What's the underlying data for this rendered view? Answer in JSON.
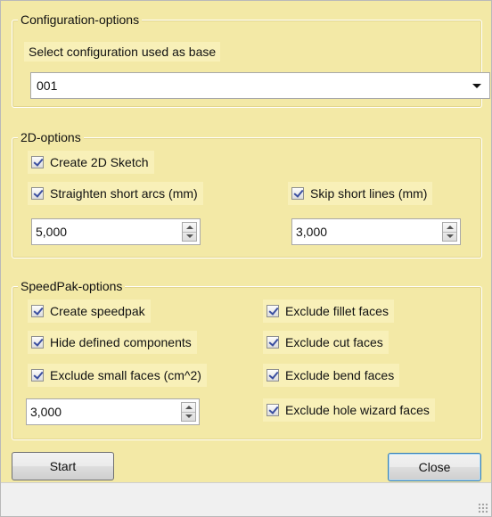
{
  "config": {
    "legend": "Configuration-options",
    "select_label": "Select configuration used as base",
    "selected": "001"
  },
  "twod": {
    "legend": "2D-options",
    "create_sketch": {
      "label": "Create 2D Sketch",
      "checked": true
    },
    "straighten_arcs": {
      "label": "Straighten short arcs (mm)",
      "checked": true
    },
    "straighten_value": "5,000",
    "skip_lines": {
      "label": "Skip short lines (mm)",
      "checked": true
    },
    "skip_value": "3,000"
  },
  "speedpak": {
    "legend": "SpeedPak-options",
    "create_speedpak": {
      "label": "Create speedpak",
      "checked": true
    },
    "hide_components": {
      "label": "Hide defined components",
      "checked": true
    },
    "exclude_small": {
      "label": "Exclude small faces (cm^2)",
      "checked": true
    },
    "small_value": "3,000",
    "exclude_fillet": {
      "label": "Exclude fillet faces",
      "checked": true
    },
    "exclude_cut": {
      "label": "Exclude cut faces",
      "checked": true
    },
    "exclude_bend": {
      "label": "Exclude bend faces",
      "checked": true
    },
    "exclude_hole": {
      "label": "Exclude hole wizard faces",
      "checked": true
    }
  },
  "buttons": {
    "start": "Start",
    "close": "Close"
  },
  "colors": {
    "panel": "#f3e9a6",
    "checkmark": "#3b4fa0"
  }
}
